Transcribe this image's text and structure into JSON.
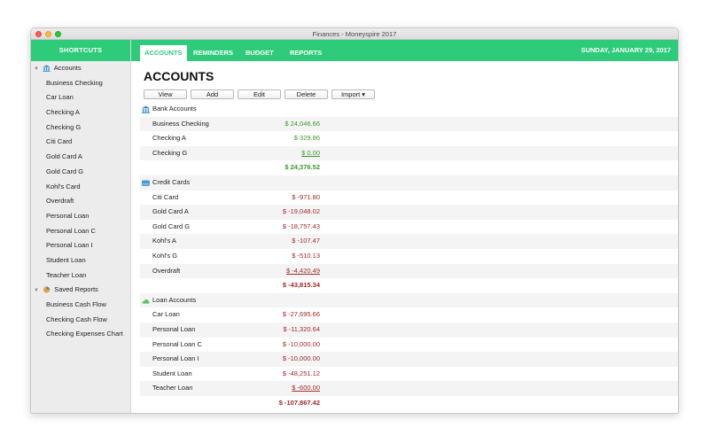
{
  "window": {
    "title": "Finances - Moneyspire 2017"
  },
  "sidebar": {
    "header": "SHORTCUTS",
    "groups": [
      {
        "label": "Accounts",
        "icon": "bank-icon",
        "items": [
          "Business Checking",
          "Car Loan",
          "Checking A",
          "Checking G",
          "Citi Card",
          "Gold Card A",
          "Gold Card G",
          "Kohl's Card",
          "Overdraft",
          "Personal Loan",
          "Personal Loan C",
          "Personal Loan I",
          "Student Loan",
          "Teacher Loan"
        ]
      },
      {
        "label": "Saved Reports",
        "icon": "reports-icon",
        "items": [
          "Business Cash Flow",
          "Checking Cash Flow",
          "Checking Expenses Chart"
        ]
      }
    ]
  },
  "tabs": [
    "ACCOUNTS",
    "REMINDERS",
    "BUDGET",
    "REPORTS"
  ],
  "active_tab": "ACCOUNTS",
  "date": "SUNDAY, JANUARY 29, 2017",
  "page": {
    "title": "ACCOUNTS",
    "toolbar": {
      "view": "View",
      "add": "Add",
      "edit": "Edit",
      "delete": "Delete",
      "import": "Import ▾"
    }
  },
  "sections": [
    {
      "label": "Bank Accounts",
      "icon": "bank-icon",
      "accounts": [
        {
          "name": "Business Checking",
          "amount": "$ 24,046.66"
        },
        {
          "name": "Checking A",
          "amount": "$ 329.86"
        },
        {
          "name": "Checking G",
          "amount": "$ 0.00"
        }
      ],
      "total": "$ 24,376.52"
    },
    {
      "label": "Credit Cards",
      "icon": "credit-card-icon",
      "accounts": [
        {
          "name": "Citi Card",
          "amount": "$ -971.80"
        },
        {
          "name": "Gold Card A",
          "amount": "$ -19,048.02"
        },
        {
          "name": "Gold Card G",
          "amount": "$ -18,757.43"
        },
        {
          "name": "Kohl's A",
          "amount": "$ -107.47"
        },
        {
          "name": "Kohl's G",
          "amount": "$ -510.13"
        },
        {
          "name": "Overdraft",
          "amount": "$ -4,420.49"
        }
      ],
      "total": "$ -43,815.34"
    },
    {
      "label": "Loan Accounts",
      "icon": "loan-icon",
      "accounts": [
        {
          "name": "Car Loan",
          "amount": "$ -27,695.66"
        },
        {
          "name": "Personal Loan",
          "amount": "$ -11,320.64"
        },
        {
          "name": "Personal Loan C",
          "amount": "$ -10,000.00"
        },
        {
          "name": "Personal Loan I",
          "amount": "$ -10,000.00"
        },
        {
          "name": "Student Loan",
          "amount": "$ -48,251.12"
        },
        {
          "name": "Teacher Loan",
          "amount": "$ -600.00"
        }
      ],
      "total": "$ -107,867.42"
    }
  ],
  "colors": {
    "accent": "#2ecc7a",
    "positive": "#3a9a2a",
    "negative": "#a22a2a"
  }
}
